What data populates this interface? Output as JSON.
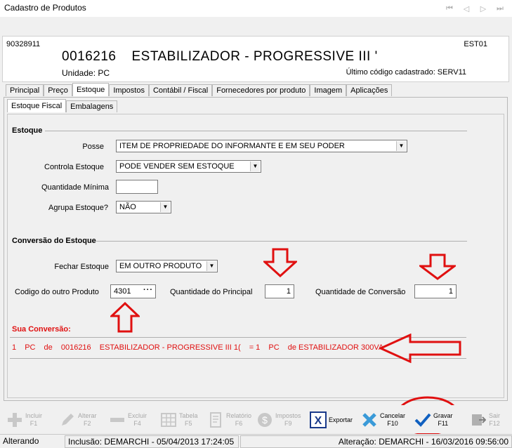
{
  "window": {
    "title": "Cadastro de Produtos"
  },
  "nav": [
    "first-icon",
    "prev-icon",
    "next-icon",
    "last-icon"
  ],
  "header": {
    "code": "90328911",
    "est": "EST01",
    "product_code": "0016216",
    "product_name": "ESTABILIZADOR -  PROGRESSIVE III '",
    "unidade": "Unidade:  PC",
    "ultimo": "Último código cadastrado: SERV11"
  },
  "tabs": [
    "Principal",
    "Preço",
    "Estoque",
    "Impostos",
    "Contábil / Fiscal",
    "Fornecedores por produto",
    "Imagem",
    "Aplicações"
  ],
  "subtabs": [
    "Estoque Fiscal",
    "Embalagens"
  ],
  "estoque": {
    "section": "Estoque",
    "posse_label": "Posse",
    "posse_value": "ITEM DE PROPRIEDADE DO INFORMANTE E EM SEU PODER",
    "controla_label": "Controla Estoque",
    "controla_value": "PODE VENDER SEM ESTOQUE",
    "qtd_min_label": "Quantidade Mínima",
    "qtd_min_value": "",
    "agrupa_label": "Agrupa Estoque?",
    "agrupa_value": "NÃO"
  },
  "conversao": {
    "section": "Conversão do Estoque",
    "fechar_label": "Fechar Estoque",
    "fechar_value": "EM OUTRO PRODUTO",
    "codigo_label": "Codigo do outro Produto",
    "codigo_value": "4301",
    "qtd_principal_label": "Quantidade do Principal",
    "qtd_principal_value": "1",
    "qtd_conversao_label": "Quantidade de Conversão",
    "qtd_conversao_value": "1",
    "sua_label": "Sua Conversão:",
    "line": {
      "qty": "1",
      "unit": "PC",
      "de1": "de",
      "code": "0016216",
      "name": "ESTABILIZADOR -  PROGRESSIVE III 1(",
      "eq": "= 1",
      "unit2": "PC",
      "de2": "de ESTABILIZADOR 300VA"
    }
  },
  "toolbar": {
    "incluir": [
      "Incluir",
      "F1"
    ],
    "alterar": [
      "Alterar",
      "F2"
    ],
    "excluir": [
      "Excluir",
      "F4"
    ],
    "tabela": [
      "Tabela",
      "F5"
    ],
    "relatorio": [
      "Relatório",
      "F6"
    ],
    "impostos": [
      "Impostos",
      "F9"
    ],
    "exportar": [
      "Exportar"
    ],
    "cancelar": [
      "Cancelar",
      "F10"
    ],
    "gravar": [
      "Gravar",
      "F11"
    ],
    "sair": [
      "Sair",
      "F12"
    ]
  },
  "status": {
    "mode": "Alterando",
    "inclusao": "Inclusão: DEMARCHI - 05/04/2013 17:24:05",
    "alteracao": "Alteração: DEMARCHI - 16/03/2016 09:56:00"
  },
  "colors": {
    "annotation_red": "#e01010",
    "accent_blue": "#1060c0"
  }
}
